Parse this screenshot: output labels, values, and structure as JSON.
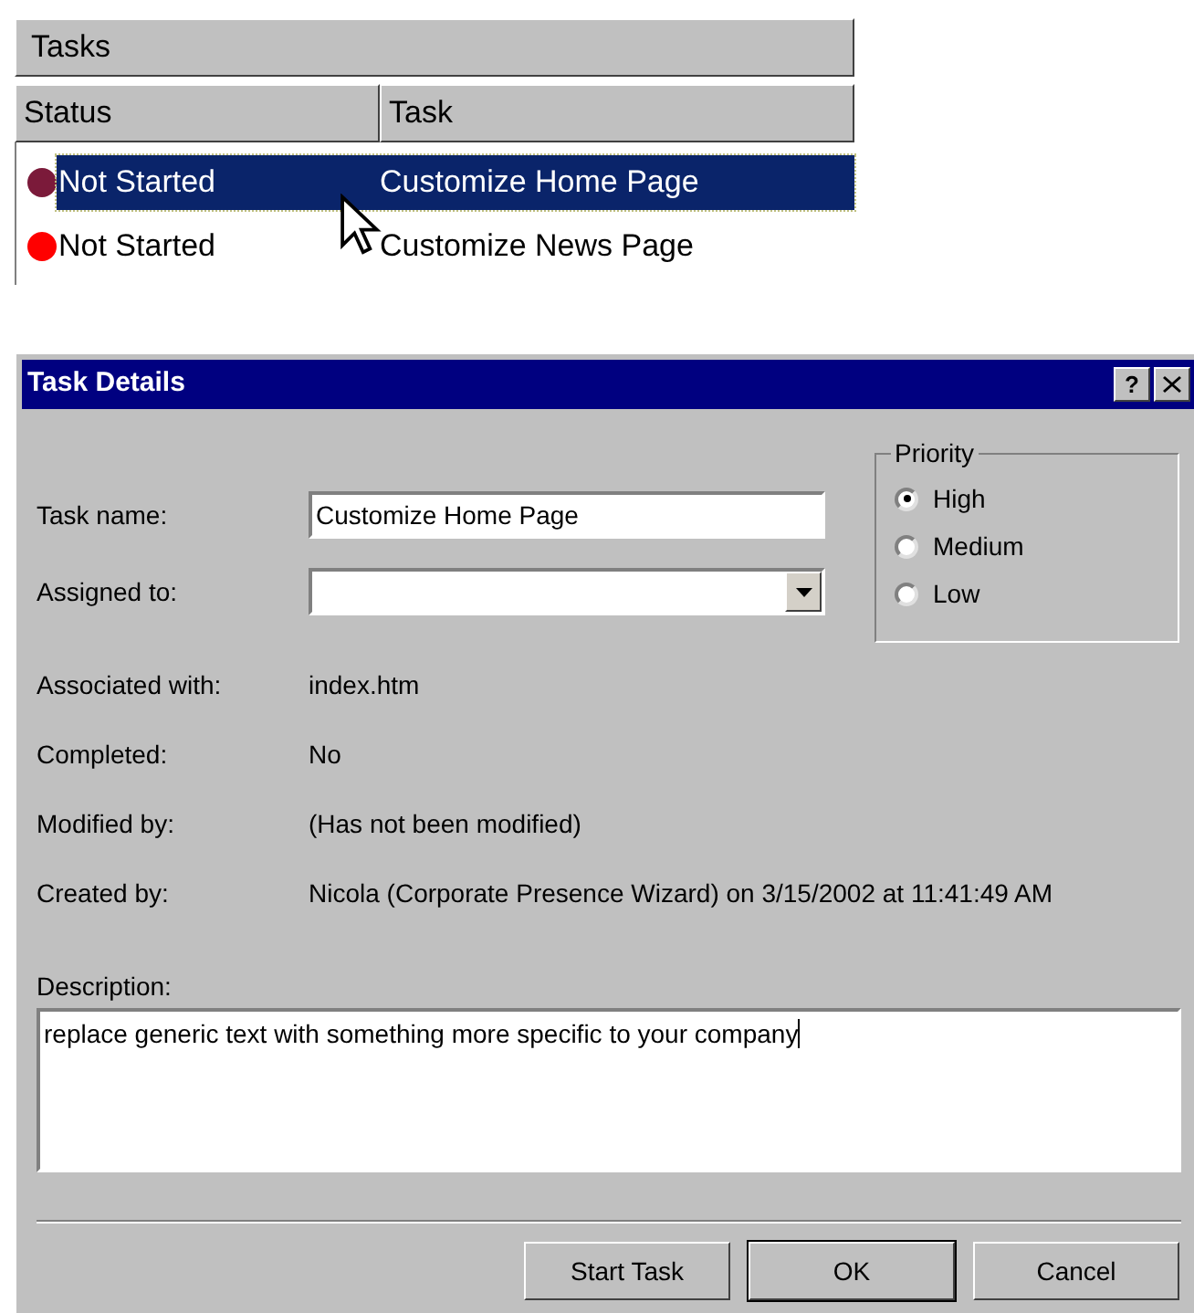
{
  "tasks_panel": {
    "title": "Tasks",
    "columns": [
      "Status",
      "Task"
    ],
    "rows": [
      {
        "status": "Not Started",
        "task": "Customize Home Page",
        "color": "#7b1a3a",
        "selected": true
      },
      {
        "status": "Not Started",
        "task": "Customize News Page",
        "color": "#ff0000",
        "selected": false
      }
    ]
  },
  "dialog": {
    "title": "Task Details",
    "help_button": "?",
    "fields": [
      {
        "kind": "input",
        "label": "Task name:",
        "value": "Customize Home Page"
      },
      {
        "kind": "dropdown",
        "label": "Assigned to:"
      },
      {
        "kind": "static",
        "label": "Associated with:",
        "value": "index.htm"
      },
      {
        "kind": "static",
        "label": "Completed:",
        "value": "No"
      },
      {
        "kind": "static",
        "label": "Modified by:",
        "value": "(Has not been modified)"
      },
      {
        "kind": "static",
        "label": "Created by:",
        "value": "Nicola (Corporate Presence Wizard) on 3/15/2002 at 11:41:49 AM"
      }
    ],
    "priority": {
      "label": "Priority",
      "options": [
        {
          "label": "High",
          "selected": true
        },
        {
          "label": "Medium",
          "selected": false
        },
        {
          "label": "Low",
          "selected": false
        }
      ]
    },
    "description": {
      "label": "Description:",
      "value": "replace generic text with something more specific to your company"
    },
    "buttons": [
      {
        "label": "Start Task",
        "default": false
      },
      {
        "label": "OK",
        "default": true
      },
      {
        "label": "Cancel",
        "default": false
      }
    ]
  }
}
